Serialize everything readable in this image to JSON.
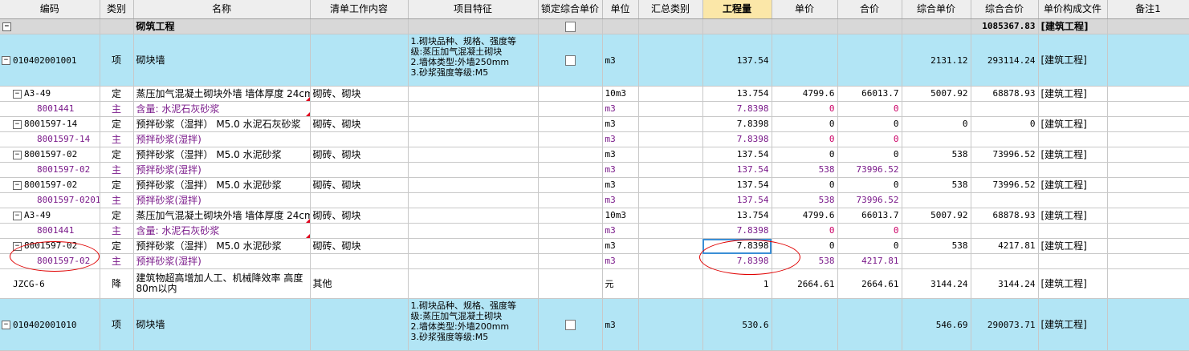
{
  "columns": [
    "编码",
    "类别",
    "名称",
    "清单工作内容",
    "项目特征",
    "锁定综合单价",
    "单位",
    "汇总类别",
    "工程量",
    "单价",
    "合价",
    "综合单价",
    "综合合价",
    "单价构成文件",
    "备注1"
  ],
  "section": {
    "name": "砌筑工程",
    "total": "1085367.83",
    "file": "[建筑工程]"
  },
  "item1": {
    "code": "010402001001",
    "type": "项",
    "name": "砌块墙",
    "features": [
      "1.砌块品种、规格、强度等",
      "级:蒸压加气混凝土砌块",
      "2.墙体类型:外墙250mm",
      "3.砂浆强度等级:M5"
    ],
    "unit": "m3",
    "qty": "137.54",
    "unit_price": "",
    "total_price": "",
    "comp_price": "2131.12",
    "comp_total": "293114.24",
    "file": "[建筑工程]"
  },
  "rows": [
    {
      "code": "A3-49",
      "type": "定",
      "name": "蒸压加气混凝土砌块外墙 墙体厚度 24cm",
      "work": "砌砖、砌块",
      "unit": "10m3",
      "qty": "13.754",
      "up": "4799.6",
      "tp": "66013.7",
      "cp": "5007.92",
      "ct": "68878.93",
      "file": "[建筑工程]"
    },
    {
      "code": "8001441",
      "type": "主",
      "name": "含量: 水泥石灰砂浆",
      "work": "",
      "unit": "m3",
      "qty": "7.8398",
      "up": "0",
      "tp": "0",
      "cp": "",
      "ct": "",
      "file": ""
    },
    {
      "code": "8001597-14",
      "type": "定",
      "name": "预拌砂浆（湿拌） M5.0 水泥石灰砂浆",
      "work": "砌砖、砌块",
      "unit": "m3",
      "qty": "7.8398",
      "up": "0",
      "tp": "0",
      "cp": "0",
      "ct": "0",
      "file": "[建筑工程]"
    },
    {
      "code": "8001597-14",
      "type": "主",
      "name": "预拌砂浆(湿拌)",
      "work": "",
      "unit": "m3",
      "qty": "7.8398",
      "up": "0",
      "tp": "0",
      "cp": "",
      "ct": "",
      "file": ""
    },
    {
      "code": "8001597-02",
      "type": "定",
      "name": "预拌砂浆（湿拌） M5.0 水泥砂浆",
      "work": "砌砖、砌块",
      "unit": "m3",
      "qty": "137.54",
      "up": "0",
      "tp": "0",
      "cp": "538",
      "ct": "73996.52",
      "file": "[建筑工程]"
    },
    {
      "code": "8001597-02",
      "type": "主",
      "name": "预拌砂浆(湿拌)",
      "work": "",
      "unit": "m3",
      "qty": "137.54",
      "up": "538",
      "tp": "73996.52",
      "cp": "",
      "ct": "",
      "file": ""
    },
    {
      "code": "8001597-02",
      "type": "定",
      "name": "预拌砂浆（湿拌） M5.0 水泥砂浆",
      "work": "砌砖、砌块",
      "unit": "m3",
      "qty": "137.54",
      "up": "0",
      "tp": "0",
      "cp": "538",
      "ct": "73996.52",
      "file": "[建筑工程]"
    },
    {
      "code": "8001597-0201",
      "type": "主",
      "name": "预拌砂浆(湿拌)",
      "work": "",
      "unit": "m3",
      "qty": "137.54",
      "up": "538",
      "tp": "73996.52",
      "cp": "",
      "ct": "",
      "file": ""
    },
    {
      "code": "A3-49",
      "type": "定",
      "name": "蒸压加气混凝土砌块外墙 墙体厚度 24cm",
      "work": "砌砖、砌块",
      "unit": "10m3",
      "qty": "13.754",
      "up": "4799.6",
      "tp": "66013.7",
      "cp": "5007.92",
      "ct": "68878.93",
      "file": "[建筑工程]"
    },
    {
      "code": "8001441",
      "type": "主",
      "name": "含量: 水泥石灰砂浆",
      "work": "",
      "unit": "m3",
      "qty": "7.8398",
      "up": "0",
      "tp": "0",
      "cp": "",
      "ct": "",
      "file": ""
    },
    {
      "code": "8001597-02",
      "type": "定",
      "name": "预拌砂浆（湿拌） M5.0 水泥砂浆",
      "work": "砌砖、砌块",
      "unit": "m3",
      "qty": "7.8398",
      "up": "0",
      "tp": "0",
      "cp": "538",
      "ct": "4217.81",
      "file": "[建筑工程]"
    },
    {
      "code": "8001597-02",
      "type": "主",
      "name": "预拌砂浆(湿拌)",
      "work": "",
      "unit": "m3",
      "qty": "7.8398",
      "up": "538",
      "tp": "4217.81",
      "cp": "",
      "ct": "",
      "file": ""
    },
    {
      "code": "JZCG-6",
      "type": "降",
      "name": "建筑物超高增加人工、机械降效率 高度80m以内",
      "work": "其他",
      "unit": "元",
      "qty": "1",
      "up": "2664.61",
      "tp": "2664.61",
      "cp": "3144.24",
      "ct": "3144.24",
      "file": "[建筑工程]"
    }
  ],
  "item2": {
    "code": "010402001010",
    "type": "项",
    "name": "砌块墙",
    "features": [
      "1.砌块品种、规格、强度等",
      "级:蒸压加气混凝土砌块",
      "2.墙体类型:外墙200mm",
      "3.砂浆强度等级:M5"
    ],
    "unit": "m3",
    "qty": "530.6",
    "comp_price": "546.69",
    "comp_total": "290073.71",
    "file": "[建筑工程]"
  },
  "colors": {
    "header_bg": "#eeeeee",
    "qty_header_bg": "#fbe7a8",
    "item_bg": "#b2e5f5",
    "section_bg": "#d8d8d8",
    "material_text": "#7a1a8a",
    "annotation": "#e00000"
  }
}
